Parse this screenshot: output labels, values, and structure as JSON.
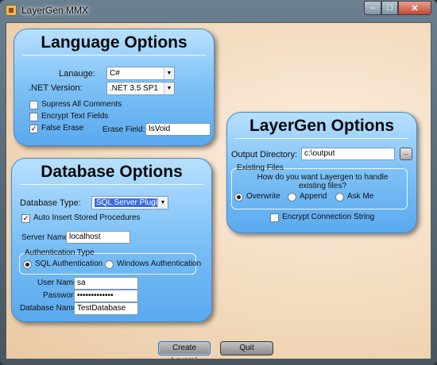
{
  "window": {
    "title": "LayerGen MMX",
    "min": "–",
    "max": "□",
    "close": "✕"
  },
  "language": {
    "title": "Language Options",
    "language_label": "Lanauge:",
    "language_value": "C#",
    "net_label": ".NET Version:",
    "net_value": ".NET 3.5 SP1",
    "suppress_label": "Supress All Comments",
    "suppress_checked": "",
    "encrypt_label": "Encrypt Text Fields",
    "encrypt_checked": "",
    "false_erase_label": "False Erase",
    "false_erase_checked": "✓",
    "erase_field_label": "Erase Field:",
    "erase_field_value": "IsVoid"
  },
  "database": {
    "title": "Database Options",
    "type_label": "Database Type:",
    "type_value": "SQL Server Plugin",
    "auto_insert_label": "Auto Insert Stored Procedures",
    "auto_insert_checked": "✓",
    "server_label": "Server Name:",
    "server_value": "localhost",
    "auth_legend": "Authentication Type",
    "auth_sql": "SQL Authentication",
    "auth_windows": "Windows Authentication",
    "user_label": "User Name:",
    "user_value": "sa",
    "password_label": "Password:",
    "password_value": "•••••••••••••",
    "dbname_label": "Database Name:",
    "dbname_value": "TestDatabase"
  },
  "layergen": {
    "title": "LayerGen Options",
    "output_label": "Output Directory:",
    "output_value": "c:\\output",
    "browse": "...",
    "existing_legend": "Existing Files",
    "question": "How do you want Layergen to handle existing files?",
    "overwrite": "Overwrite",
    "append": "Append",
    "ask": "Ask Me",
    "encrypt_conn_label": "Encrypt Connection String",
    "encrypt_conn_checked": ""
  },
  "actions": {
    "create": "Create Layers!",
    "quit": "Quit"
  }
}
